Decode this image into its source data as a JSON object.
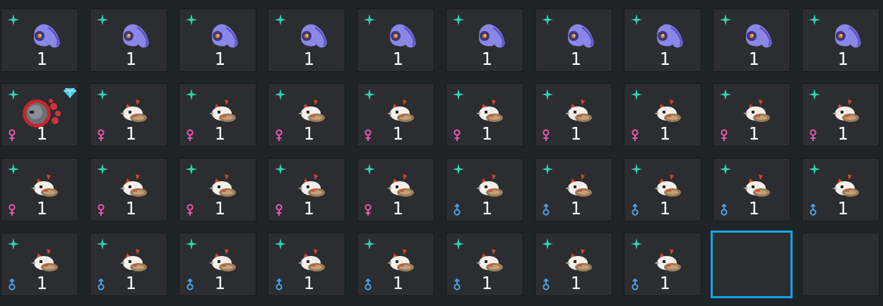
{
  "colors": {
    "background": "#1f2429",
    "slot": "#2b2d30",
    "selected_border": "#14a3e6",
    "sparkle": "#2fd4ad",
    "female": "#e55aa9",
    "male": "#4aa0e8",
    "count_text": "#ffffff"
  },
  "slots": [
    {
      "species": "ghost-pokemon-icon",
      "count": "1",
      "gender": "",
      "shiny": true
    },
    {
      "species": "ghost-pokemon-icon",
      "count": "1",
      "gender": "",
      "shiny": true
    },
    {
      "species": "ghost-pokemon-icon",
      "count": "1",
      "gender": "",
      "shiny": true
    },
    {
      "species": "ghost-pokemon-icon",
      "count": "1",
      "gender": "",
      "shiny": true
    },
    {
      "species": "ghost-pokemon-icon",
      "count": "1",
      "gender": "",
      "shiny": true
    },
    {
      "species": "ghost-pokemon-icon",
      "count": "1",
      "gender": "",
      "shiny": true
    },
    {
      "species": "ghost-pokemon-icon",
      "count": "1",
      "gender": "",
      "shiny": true
    },
    {
      "species": "ghost-pokemon-icon",
      "count": "1",
      "gender": "",
      "shiny": true
    },
    {
      "species": "ghost-pokemon-icon",
      "count": "1",
      "gender": "",
      "shiny": true
    },
    {
      "species": "ghost-pokemon-icon",
      "count": "1",
      "gender": "",
      "shiny": true
    },
    {
      "species": "red-orb-pokemon-icon",
      "count": "1",
      "gender": "female",
      "shiny": true,
      "gem": true
    },
    {
      "species": "bird-pokemon-icon",
      "count": "1",
      "gender": "female",
      "shiny": true
    },
    {
      "species": "bird-pokemon-icon",
      "count": "1",
      "gender": "female",
      "shiny": true
    },
    {
      "species": "bird-pokemon-icon",
      "count": "1",
      "gender": "female",
      "shiny": true
    },
    {
      "species": "bird-pokemon-icon",
      "count": "1",
      "gender": "female",
      "shiny": true
    },
    {
      "species": "bird-pokemon-icon",
      "count": "1",
      "gender": "female",
      "shiny": true
    },
    {
      "species": "bird-pokemon-icon",
      "count": "1",
      "gender": "female",
      "shiny": true
    },
    {
      "species": "bird-pokemon-icon",
      "count": "1",
      "gender": "female",
      "shiny": true
    },
    {
      "species": "bird-pokemon-icon",
      "count": "1",
      "gender": "female",
      "shiny": true
    },
    {
      "species": "bird-pokemon-icon",
      "count": "1",
      "gender": "female",
      "shiny": true
    },
    {
      "species": "bird-pokemon-icon",
      "count": "1",
      "gender": "female",
      "shiny": true
    },
    {
      "species": "bird-pokemon-icon",
      "count": "1",
      "gender": "female",
      "shiny": true
    },
    {
      "species": "bird-pokemon-icon",
      "count": "1",
      "gender": "female",
      "shiny": true
    },
    {
      "species": "bird-pokemon-icon",
      "count": "1",
      "gender": "female",
      "shiny": true
    },
    {
      "species": "bird-pokemon-icon",
      "count": "1",
      "gender": "female",
      "shiny": true
    },
    {
      "species": "bird-pokemon-icon",
      "count": "1",
      "gender": "male",
      "shiny": true
    },
    {
      "species": "bird-pokemon-icon",
      "count": "1",
      "gender": "male",
      "shiny": true
    },
    {
      "species": "bird-pokemon-icon",
      "count": "1",
      "gender": "male",
      "shiny": true
    },
    {
      "species": "bird-pokemon-icon",
      "count": "1",
      "gender": "male",
      "shiny": true
    },
    {
      "species": "bird-pokemon-icon",
      "count": "1",
      "gender": "male",
      "shiny": true
    },
    {
      "species": "bird-pokemon-icon",
      "count": "1",
      "gender": "male",
      "shiny": true
    },
    {
      "species": "bird-pokemon-icon",
      "count": "1",
      "gender": "male",
      "shiny": true
    },
    {
      "species": "bird-pokemon-icon",
      "count": "1",
      "gender": "male",
      "shiny": true
    },
    {
      "species": "bird-pokemon-icon",
      "count": "1",
      "gender": "male",
      "shiny": true
    },
    {
      "species": "bird-pokemon-icon",
      "count": "1",
      "gender": "male",
      "shiny": true
    },
    {
      "species": "bird-pokemon-icon",
      "count": "1",
      "gender": "male",
      "shiny": true
    },
    {
      "species": "bird-pokemon-icon",
      "count": "1",
      "gender": "male",
      "shiny": true
    },
    {
      "species": "bird-pokemon-icon",
      "count": "1",
      "gender": "male",
      "shiny": true
    },
    {
      "species": "",
      "count": "",
      "gender": "",
      "shiny": false,
      "selected": true
    },
    {
      "species": "",
      "count": "",
      "gender": "",
      "shiny": false
    }
  ]
}
